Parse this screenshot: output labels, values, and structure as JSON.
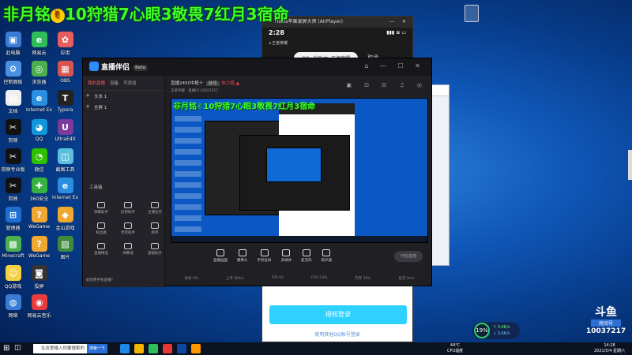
{
  "overlay": {
    "title": "非月铭",
    "badge": "✌",
    "title_rest": "10狩猎7心眼3敬畏7红月3宿命"
  },
  "desktop_icons": [
    {
      "label": "此电脑",
      "color": "#3a7bd5",
      "glyph": "▣"
    },
    {
      "label": "网易云",
      "color": "#2ebd59",
      "glyph": "e"
    },
    {
      "label": "应用",
      "color": "#e85d5d",
      "glyph": "✿"
    },
    {
      "label": "控制面板",
      "color": "#4a90e2",
      "glyph": "⚙"
    },
    {
      "label": "浏览器",
      "color": "#4cae4c",
      "glyph": "◎"
    },
    {
      "label": "OBS",
      "color": "#d9534f",
      "glyph": "▦"
    },
    {
      "label": "文档",
      "color": "#f0f0f0",
      "glyph": "▤"
    },
    {
      "label": "Internet Explorer",
      "color": "#2a8fe0",
      "glyph": "e"
    },
    {
      "label": "Typora",
      "color": "#222222",
      "glyph": "T"
    },
    {
      "label": "剪映",
      "color": "#111111",
      "glyph": "✂"
    },
    {
      "label": "QQ",
      "color": "#1296db",
      "glyph": "◕"
    },
    {
      "label": "UltraEdit",
      "color": "#7a3b9a",
      "glyph": "U"
    },
    {
      "label": "剪映专业版",
      "color": "#111111",
      "glyph": "✂"
    },
    {
      "label": "微信",
      "color": "#2dc100",
      "glyph": "◔"
    },
    {
      "label": "截图工具",
      "color": "#5bc0de",
      "glyph": "◫"
    },
    {
      "label": "剪映",
      "color": "#111111",
      "glyph": "✂"
    },
    {
      "label": "360安全",
      "color": "#36b240",
      "glyph": "✚"
    },
    {
      "label": "Internet Explorer",
      "color": "#2a8fe0",
      "glyph": "e"
    },
    {
      "label": "管理器",
      "color": "#1f6fd1",
      "glyph": "⊞"
    },
    {
      "label": "WeGame",
      "color": "#f0a830",
      "glyph": "?"
    },
    {
      "label": "金山游戏",
      "color": "#f0a830",
      "glyph": "◆"
    },
    {
      "label": "Minecraft",
      "color": "#4caf50",
      "glyph": "▩"
    },
    {
      "label": "WeGame",
      "color": "#f0a830",
      "glyph": "?"
    },
    {
      "label": "图片",
      "color": "#3d8b3d",
      "glyph": "▨"
    },
    {
      "label": "QQ游戏",
      "color": "#f5d042",
      "glyph": "☺"
    },
    {
      "label": "投屏",
      "color": "#333333",
      "glyph": "◙"
    },
    {
      "label": "",
      "color": "transparent",
      "glyph": ""
    },
    {
      "label": "网络",
      "color": "#3a7bd5",
      "glyph": "◍"
    },
    {
      "label": "网易云音乐",
      "color": "#e63c3c",
      "glyph": "◉"
    }
  ],
  "itools": {
    "window_title": "iTools苹果录屏大师 (AirPlayer)",
    "time": "2:28",
    "signal": "▮▮▮ ≋ ▭",
    "sub": "◂ 王者荣耀",
    "prompt": "QQ · 钻贴由: 王者荣耀",
    "cancel": "取消",
    "login_button": "授权登录",
    "other_login": "使用其他QQ帐号登录"
  },
  "app": {
    "logo": "直播伴侣",
    "version": "Beta",
    "window_controls": "⌂ — ☐ ✕",
    "left_tabs": [
      "我的直播",
      "设备",
      "可添加"
    ],
    "scenes": [
      "文本 1",
      "全屏 1"
    ],
    "tools_title": "工具箱",
    "tools": [
      "弹幕助手",
      "房管助手",
      "主播任务",
      "粉丝群",
      "贵宾助手",
      "榜单",
      "直播精选",
      "弹幕墙",
      "基础助手"
    ],
    "bottom_note": "如何用手机直播?",
    "room_title": "直播2450中枢十",
    "room_tag": "游戏",
    "room_hot": "热力值 ▲",
    "game_info": "王者荣耀 · 直播间 10037217",
    "head_icons": "▣ ⊡ ⊟ ♫ ◎",
    "preview_title": "非月铭✌10狩猎7心眼3敬畏7红月3宿命",
    "controls": [
      "直播画面",
      "摄像头",
      "手机投屏",
      "多媒体",
      "麦克风",
      "扬声器"
    ],
    "start_label": "开始直播",
    "stats": [
      "丢帧 0%",
      "上传 0Kb/s",
      "FPS 60",
      "CPU 23%",
      "内存 26%",
      "延迟 0ms"
    ]
  },
  "douyu": {
    "logo": "斗鱼",
    "tag": "房间号",
    "room_id": "10037217"
  },
  "speed": {
    "percent": "19%",
    "up": "↑ 3.4K/s",
    "down": "↓ 3.6K/s"
  },
  "taskbar": {
    "search_placeholder": "在这里输入你要搜索的内容",
    "search_btn": "搜索一下",
    "tray_temp": "44°C",
    "tray_label": "CPU温度",
    "time": "14:28",
    "date": "2021/5/4 星期六"
  }
}
